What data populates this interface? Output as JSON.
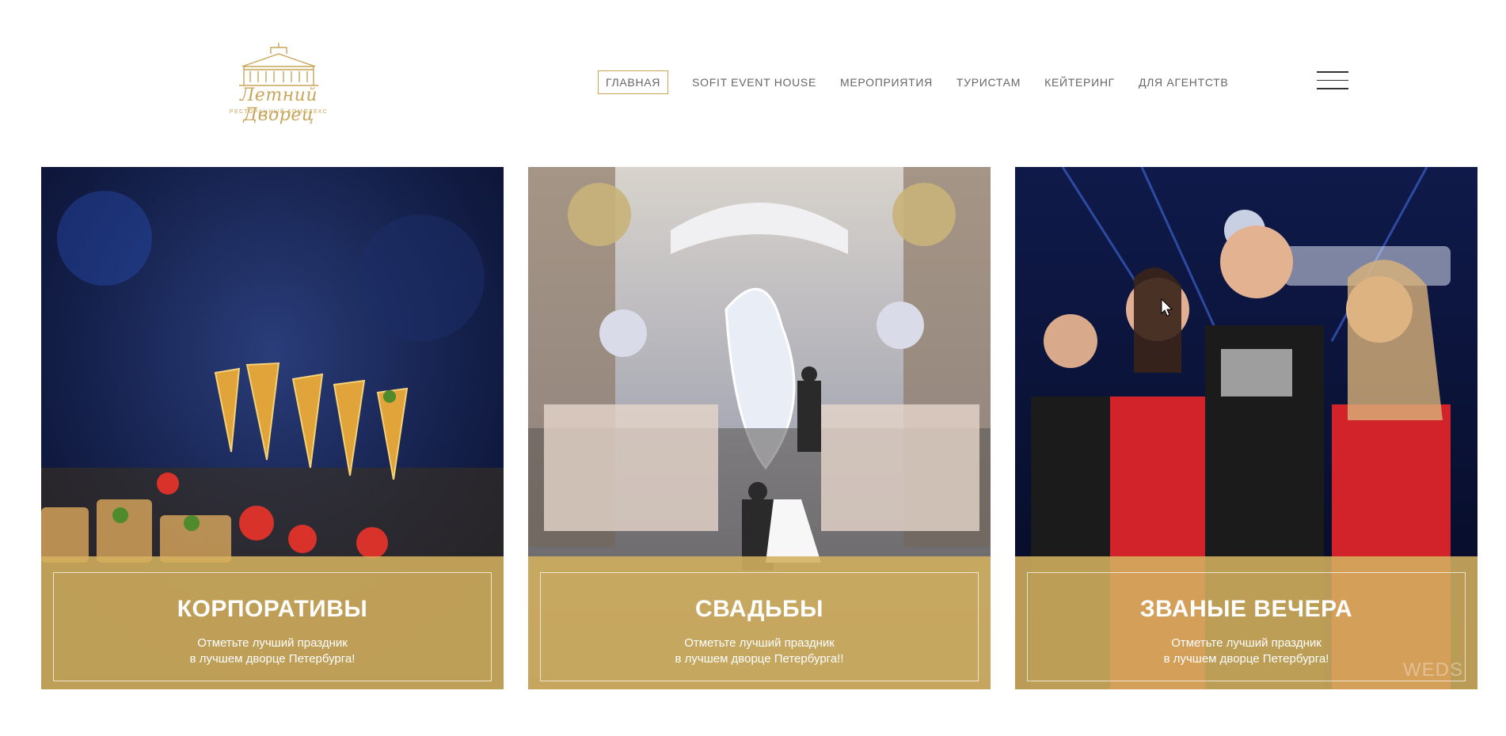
{
  "header": {
    "logo_title": "Летний Дворец",
    "logo_subtitle": "ресторанный комплекс",
    "nav": [
      {
        "label": "ГЛАВНАЯ"
      },
      {
        "label": "SOFIT EVENT HOUSE"
      },
      {
        "label": "МЕРОПРИЯТИЯ"
      },
      {
        "label": "ТУРИСТАМ"
      },
      {
        "label": "КЕЙТЕРИНГ"
      },
      {
        "label": "ДЛЯ АГЕНТСТВ"
      }
    ]
  },
  "cards": [
    {
      "title": "КОРПОРАТИВЫ",
      "line1": "Отметьте лучший праздник",
      "line2": "в лучшем дворце Петербурга!"
    },
    {
      "title": "СВАДЬБЫ",
      "line1": "Отметьте лучший праздник",
      "line2": "в лучшем дворце Петербурга!!"
    },
    {
      "title": "ЗВАНЫЕ ВЕЧЕРА",
      "line1": "Отметьте лучший праздник",
      "line2": "в лучшем дворце Петербурга!"
    }
  ],
  "watermark": "WEDS",
  "colors": {
    "accent": "#c9a55a",
    "band": "#d4b15f"
  }
}
